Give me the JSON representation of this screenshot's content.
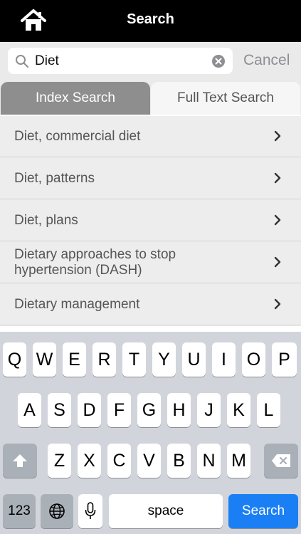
{
  "header": {
    "title": "Search"
  },
  "search": {
    "value": "Diet",
    "cancel_label": "Cancel"
  },
  "tabs": [
    {
      "label": "Index Search"
    },
    {
      "label": "Full Text Search"
    }
  ],
  "results": [
    {
      "label": "Diet, commercial diet"
    },
    {
      "label": "Diet, patterns"
    },
    {
      "label": "Diet, plans"
    },
    {
      "label": "Dietary approaches to stop hypertension (DASH)"
    },
    {
      "label": "Dietary management"
    }
  ],
  "keyboard": {
    "row1": [
      "Q",
      "W",
      "E",
      "R",
      "T",
      "Y",
      "U",
      "I",
      "O",
      "P"
    ],
    "row2": [
      "A",
      "S",
      "D",
      "F",
      "G",
      "H",
      "J",
      "K",
      "L"
    ],
    "row3": [
      "Z",
      "X",
      "C",
      "V",
      "B",
      "N",
      "M"
    ],
    "numbers_label": "123",
    "space_label": "space",
    "search_label": "Search"
  },
  "colors": {
    "accent": "#1a7ff5",
    "tab_selected": "#8e8e8e",
    "navbar": "#000000"
  },
  "icons": [
    "home-icon",
    "search-icon",
    "clear-icon",
    "chevron-right-icon",
    "shift-icon",
    "backspace-icon",
    "globe-icon",
    "microphone-icon"
  ]
}
